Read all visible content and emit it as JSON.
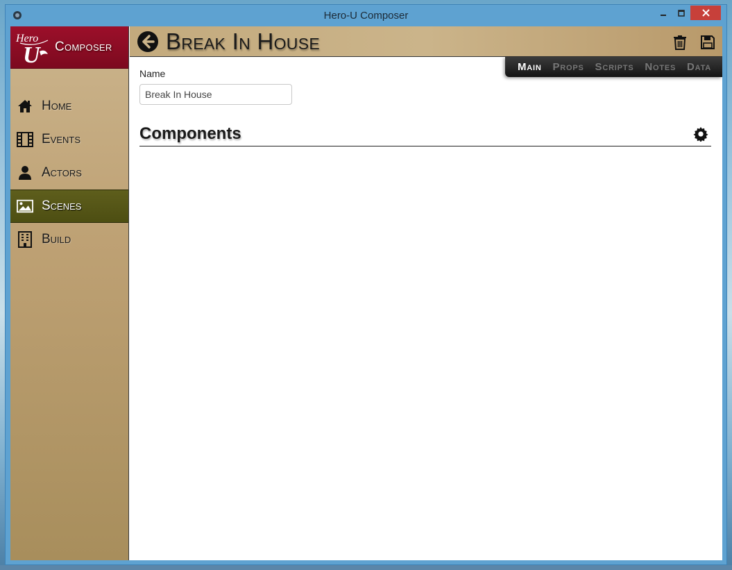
{
  "window": {
    "title": "Hero-U Composer"
  },
  "app": {
    "logo_text": "Composer",
    "logo_mark_text": "Hero U"
  },
  "sidebar": {
    "items": [
      {
        "label": "Home",
        "icon": "home-icon",
        "active": false
      },
      {
        "label": "Events",
        "icon": "film-icon",
        "active": false
      },
      {
        "label": "Actors",
        "icon": "user-icon",
        "active": false
      },
      {
        "label": "Scenes",
        "icon": "image-icon",
        "active": true
      },
      {
        "label": "Build",
        "icon": "building-icon",
        "active": false
      }
    ]
  },
  "header": {
    "title": "Break In House"
  },
  "tabs": [
    {
      "label": "Main",
      "active": true
    },
    {
      "label": "Props",
      "active": false
    },
    {
      "label": "Scripts",
      "active": false
    },
    {
      "label": "Notes",
      "active": false
    },
    {
      "label": "Data",
      "active": false
    }
  ],
  "form": {
    "name_label": "Name",
    "name_value": "Break In House"
  },
  "components": {
    "title": "Components"
  },
  "colors": {
    "brand": "#8c0d25",
    "active_nav": "#545516",
    "header_bg": "#c3aa7d",
    "titlebar": "#5ea2d1",
    "close_button": "#c7403a"
  }
}
